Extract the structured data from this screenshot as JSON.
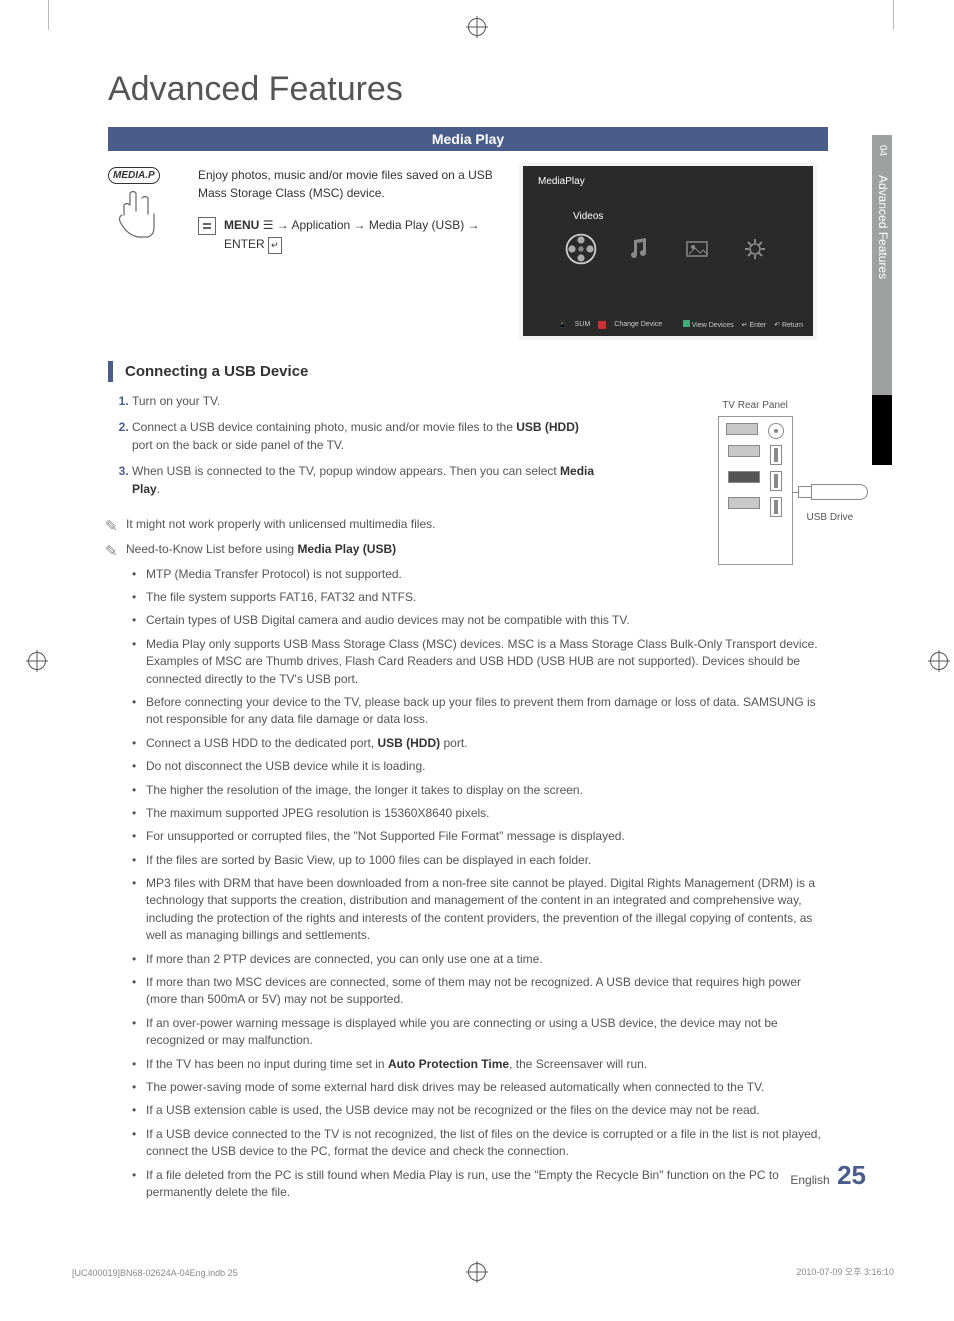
{
  "page_title": "Advanced Features",
  "side_tab": {
    "number": "04",
    "label": "Advanced Features"
  },
  "section_bar": "Media Play",
  "media_box": {
    "badge": "MEDIA.P",
    "desc": "Enjoy photos, music and/or movie files saved on a USB Mass Storage Class (MSC) device.",
    "menu_part1_bold": "MENU",
    "menu_part1_rest": " → Application → Media Play (USB) → ENTER",
    "enter_suffix": ""
  },
  "media_preview": {
    "title": "MediaPlay",
    "subtitle": "Videos",
    "footer_sum": "SUM",
    "footer_change": "Change Device",
    "footer_view": "View Devices",
    "footer_enter": "Enter",
    "footer_return": "Return"
  },
  "subheading1": "Connecting a USB Device",
  "steps": [
    "Turn on your TV.",
    "Connect a USB device containing photo, music and/or movie files to the <b>USB (HDD)</b> port on the back or side panel of the TV.",
    "When USB is connected to the TV, popup window appears. Then you can select <b>Media Play</b>."
  ],
  "panel": {
    "label": "TV Rear Panel",
    "usb_label": "USB Drive"
  },
  "note1_text": "It might not work properly with unlicensed multimedia files.",
  "note2_prefix": "Need-to-Know List before using ",
  "note2_bold": "Media Play (USB)",
  "bullets": [
    "MTP (Media Transfer Protocol) is not supported.",
    "The file system supports FAT16, FAT32 and NTFS.",
    "Certain types of USB Digital camera and audio devices may not be compatible with this TV.",
    "Media Play only supports USB Mass Storage Class (MSC) devices. MSC is a Mass Storage Class Bulk-Only Transport device. Examples of MSC are Thumb drives, Flash Card Readers and USB HDD (USB HUB are not supported). Devices should be connected directly to the TV's USB port.",
    "Before connecting your device to the TV, please back up your files to prevent them from damage or loss of data. SAMSUNG is not responsible for any data file damage or data loss.",
    "Connect a USB HDD to the dedicated port, <b>USB (HDD)</b> port.",
    "Do not disconnect the USB device while it is loading.",
    "The higher the resolution of the image, the longer it takes to display on the screen.",
    "The maximum supported JPEG resolution is 15360X8640 pixels.",
    "For unsupported or corrupted files, the \"Not Supported File Format\" message is displayed.",
    "If the files are sorted by Basic View, up to 1000 files can be displayed in each folder.",
    "MP3 files with DRM that have been downloaded from a non-free site cannot be played. Digital Rights Management (DRM) is a technology that supports the creation, distribution and management of the content in an integrated and comprehensive way, including the protection of the rights and interests of the content providers, the prevention of the illegal copying of contents, as well as managing billings and settlements.",
    "If more than 2 PTP devices are connected, you can only use one at a time.",
    "If more than two MSC devices are connected, some of them may not be recognized. A USB device that requires high power (more than 500mA or 5V) may not be supported.",
    "If an over-power warning message is displayed while you are connecting or using a USB device, the device may not be recognized or may malfunction.",
    "If the TV has been no input during time set in <b>Auto Protection Time</b>, the Screensaver will run.",
    "The power-saving mode of some external hard disk drives may be released automatically when connected to the TV.",
    "If a USB extension cable is used, the USB device may not be recognized or the files on the device may not be read.",
    "If a USB device connected to the TV is not recognized, the list of files on the device is corrupted or a file in the list is not played, connect the USB device to the PC, format the device and check the connection.",
    "If a file deleted from the PC is still found when Media Play is run, use the \"Empty the Recycle Bin\" function on the PC to permanently delete the file."
  ],
  "footer": {
    "lang": "English",
    "page": "25"
  },
  "bottom": {
    "left_file": "[UC400019]BN68-02624A-04Eng.indb   25",
    "right_ts": "2010-07-09   오후 3:16:10"
  }
}
